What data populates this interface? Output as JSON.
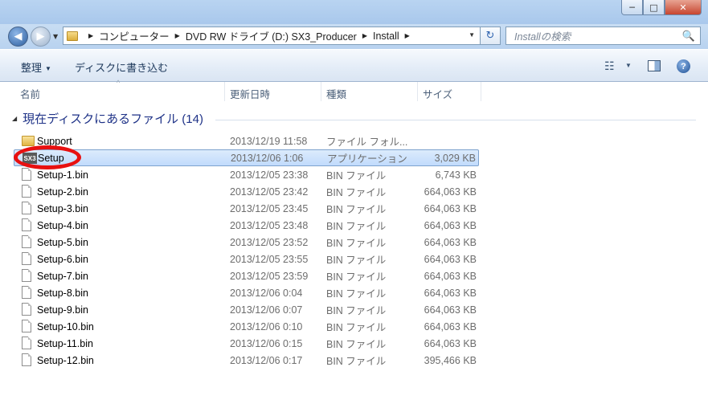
{
  "window": {
    "min_label": "─",
    "max_label": "□",
    "close_label": "✕"
  },
  "nav": {
    "back_label": "◀",
    "forward_label": "▶",
    "dropdown": "▼"
  },
  "address": {
    "crumbs": [
      "コンピューター",
      "DVD RW ドライブ (D:) SX3_Producer",
      "Install"
    ],
    "separator": "▶",
    "dropdown": "▼",
    "refresh": "↻"
  },
  "search": {
    "placeholder": "Installの検索",
    "icon": "🔍"
  },
  "toolbar": {
    "organize_label": "整理",
    "organize_arrow": "▼",
    "burn_label": "ディスクに書き込む",
    "view_icon": "☷",
    "view_arrow": "▼",
    "help_label": "?"
  },
  "columns": {
    "name": "名前",
    "date": "更新日時",
    "type": "種類",
    "size": "サイズ",
    "sort_indicator": "^"
  },
  "group": {
    "toggle": "◢",
    "label": "現在ディスクにあるファイル (14)"
  },
  "files": [
    {
      "name": "Support",
      "date": "2013/12/19 11:58",
      "type": "ファイル フォル...",
      "size": "",
      "icon": "folder-icon"
    },
    {
      "name": "Setup",
      "date": "2013/12/06 1:06",
      "type": "アプリケーション",
      "size": "3,029 KB",
      "icon": "app-icon",
      "icon_text": "SX3"
    },
    {
      "name": "Setup-1.bin",
      "date": "2013/12/05 23:38",
      "type": "BIN ファイル",
      "size": "6,743 KB",
      "icon": "file-icon"
    },
    {
      "name": "Setup-2.bin",
      "date": "2013/12/05 23:42",
      "type": "BIN ファイル",
      "size": "664,063 KB",
      "icon": "file-icon"
    },
    {
      "name": "Setup-3.bin",
      "date": "2013/12/05 23:45",
      "type": "BIN ファイル",
      "size": "664,063 KB",
      "icon": "file-icon"
    },
    {
      "name": "Setup-4.bin",
      "date": "2013/12/05 23:48",
      "type": "BIN ファイル",
      "size": "664,063 KB",
      "icon": "file-icon"
    },
    {
      "name": "Setup-5.bin",
      "date": "2013/12/05 23:52",
      "type": "BIN ファイル",
      "size": "664,063 KB",
      "icon": "file-icon"
    },
    {
      "name": "Setup-6.bin",
      "date": "2013/12/05 23:55",
      "type": "BIN ファイル",
      "size": "664,063 KB",
      "icon": "file-icon"
    },
    {
      "name": "Setup-7.bin",
      "date": "2013/12/05 23:59",
      "type": "BIN ファイル",
      "size": "664,063 KB",
      "icon": "file-icon"
    },
    {
      "name": "Setup-8.bin",
      "date": "2013/12/06 0:04",
      "type": "BIN ファイル",
      "size": "664,063 KB",
      "icon": "file-icon"
    },
    {
      "name": "Setup-9.bin",
      "date": "2013/12/06 0:07",
      "type": "BIN ファイル",
      "size": "664,063 KB",
      "icon": "file-icon"
    },
    {
      "name": "Setup-10.bin",
      "date": "2013/12/06 0:10",
      "type": "BIN ファイル",
      "size": "664,063 KB",
      "icon": "file-icon"
    },
    {
      "name": "Setup-11.bin",
      "date": "2013/12/06 0:15",
      "type": "BIN ファイル",
      "size": "664,063 KB",
      "icon": "file-icon"
    },
    {
      "name": "Setup-12.bin",
      "date": "2013/12/06 0:17",
      "type": "BIN ファイル",
      "size": "395,466 KB",
      "icon": "file-icon"
    }
  ],
  "selected_file": "Setup",
  "colors": {
    "selection_bg": "#c1dbfc",
    "highlight_ring": "#e81010",
    "group_text": "#1e3287"
  }
}
